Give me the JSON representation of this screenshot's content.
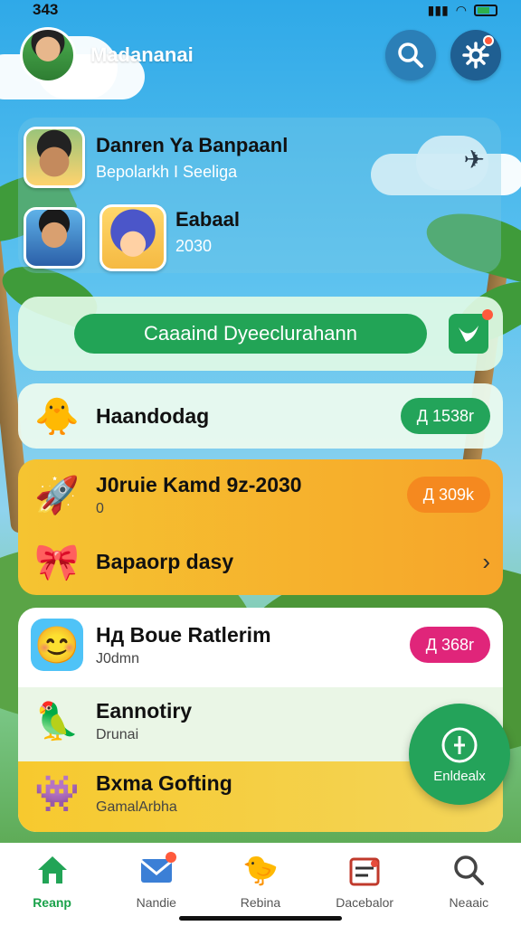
{
  "status_bar": {
    "time": "343"
  },
  "header": {
    "title": "Madananai"
  },
  "featured": {
    "item1": {
      "title": "Danren Ya Banpaanl",
      "subtitle": "Bepolarkh I​ Seeliga"
    },
    "item2": {
      "title": "Eabaal",
      "subtitle": "2030"
    }
  },
  "action": {
    "button_label": "Caaaind Dyeeclurahann"
  },
  "list": [
    {
      "title": "Haandodag",
      "subtitle": "",
      "badge": "Д 1538r"
    },
    {
      "title": "J0ruie Kamd 9z-2030",
      "subtitle": "0",
      "badge": "Д 309k"
    },
    {
      "title": "Bapaorp dasy",
      "subtitle": ""
    },
    {
      "title": "Hд Boue Ratlerim",
      "subtitle": "J0dmn",
      "badge": "Д 368r"
    },
    {
      "title": "Eannotiry",
      "subtitle": "Drunai"
    },
    {
      "title": "Bxma Gofting",
      "subtitle": "GamalАrbha"
    }
  ],
  "fab": {
    "label": "Enldealx"
  },
  "nav": [
    {
      "label": "Reanp"
    },
    {
      "label": "Nandie"
    },
    {
      "label": "Rebina"
    },
    {
      "label": "Dacebalor"
    },
    {
      "label": "Neaaic"
    }
  ],
  "colors": {
    "accent_green": "#22a456",
    "badge_orange": "#f5891f",
    "badge_pink": "#e0257a"
  }
}
